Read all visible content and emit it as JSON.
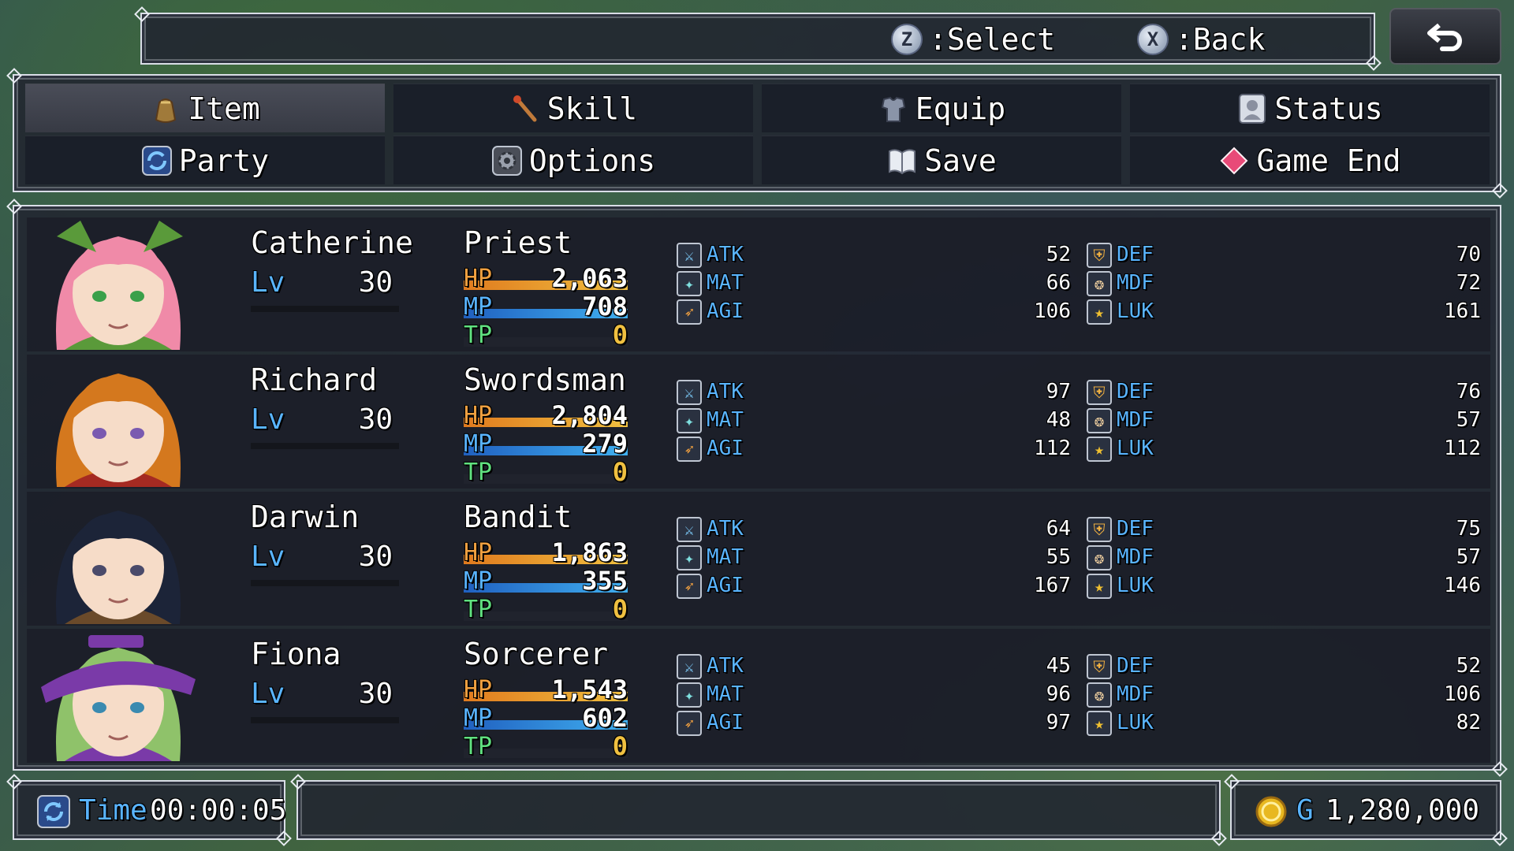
{
  "help": {
    "select_key": "Z",
    "select_label": ":Select",
    "back_key": "X",
    "back_label": ":Back"
  },
  "menu": {
    "items": [
      {
        "label": "Item",
        "icon": "bag-icon"
      },
      {
        "label": "Skill",
        "icon": "wand-icon"
      },
      {
        "label": "Equip",
        "icon": "armor-icon"
      },
      {
        "label": "Status",
        "icon": "profile-icon"
      },
      {
        "label": "Party",
        "icon": "cycle-icon"
      },
      {
        "label": "Options",
        "icon": "gear-icon"
      },
      {
        "label": "Save",
        "icon": "book-icon"
      },
      {
        "label": "Game End",
        "icon": "diamond-icon"
      }
    ],
    "selected": "Item"
  },
  "actors": [
    {
      "name": "Catherine",
      "lv_label": "Lv",
      "level": "30",
      "class": "Priest",
      "hp_label": "HP",
      "hp": "2,063",
      "hp_rate": 1.0,
      "mp_label": "MP",
      "mp": "708",
      "mp_rate": 1.0,
      "tp_label": "TP",
      "tp": "0",
      "tp_rate": 0.0,
      "stats": {
        "ATK": "52",
        "MAT": "66",
        "AGI": "106",
        "DEF": "70",
        "MDF": "72",
        "LUK": "161"
      },
      "hair": "#f08aa8",
      "accent": "#5a9a3a",
      "eyes": "#3aa04a"
    },
    {
      "name": "Richard",
      "lv_label": "Lv",
      "level": "30",
      "class": "Swordsman",
      "hp_label": "HP",
      "hp": "2,804",
      "hp_rate": 1.0,
      "mp_label": "MP",
      "mp": "279",
      "mp_rate": 1.0,
      "tp_label": "TP",
      "tp": "0",
      "tp_rate": 0.0,
      "stats": {
        "ATK": "97",
        "MAT": "48",
        "AGI": "112",
        "DEF": "76",
        "MDF": "57",
        "LUK": "112"
      },
      "hair": "#d4781e",
      "accent": "#a52a22",
      "eyes": "#7a5ab0"
    },
    {
      "name": "Darwin",
      "lv_label": "Lv",
      "level": "30",
      "class": "Bandit",
      "hp_label": "HP",
      "hp": "1,863",
      "hp_rate": 1.0,
      "mp_label": "MP",
      "mp": "355",
      "mp_rate": 1.0,
      "tp_label": "TP",
      "tp": "0",
      "tp_rate": 0.0,
      "stats": {
        "ATK": "64",
        "MAT": "55",
        "AGI": "167",
        "DEF": "75",
        "MDF": "57",
        "LUK": "146"
      },
      "hair": "#1c2438",
      "accent": "#6a4a2a",
      "eyes": "#4a4a6a"
    },
    {
      "name": "Fiona",
      "lv_label": "Lv",
      "level": "30",
      "class": "Sorcerer",
      "hp_label": "HP",
      "hp": "1,543",
      "hp_rate": 1.0,
      "mp_label": "MP",
      "mp": "602",
      "mp_rate": 1.0,
      "tp_label": "TP",
      "tp": "0",
      "tp_rate": 0.0,
      "stats": {
        "ATK": "45",
        "MAT": "96",
        "AGI": "97",
        "DEF": "52",
        "MDF": "106",
        "LUK": "82"
      },
      "hair": "#8fc26a",
      "accent": "#7a3aa8",
      "eyes": "#3a8ab0"
    }
  ],
  "footer": {
    "time_label": "Time",
    "time_value": "00:00:05",
    "currency_unit": "G",
    "gold": "1,280,000"
  },
  "colors": {
    "hp_gradient": [
      "#e07a1e",
      "#f0c040"
    ],
    "mp_gradient": [
      "#2060c0",
      "#40b0f0"
    ],
    "tp_gradient": [
      "#20a040",
      "#60e080"
    ],
    "system_label": "#59b4ff",
    "tp_value": "#f0c040"
  }
}
